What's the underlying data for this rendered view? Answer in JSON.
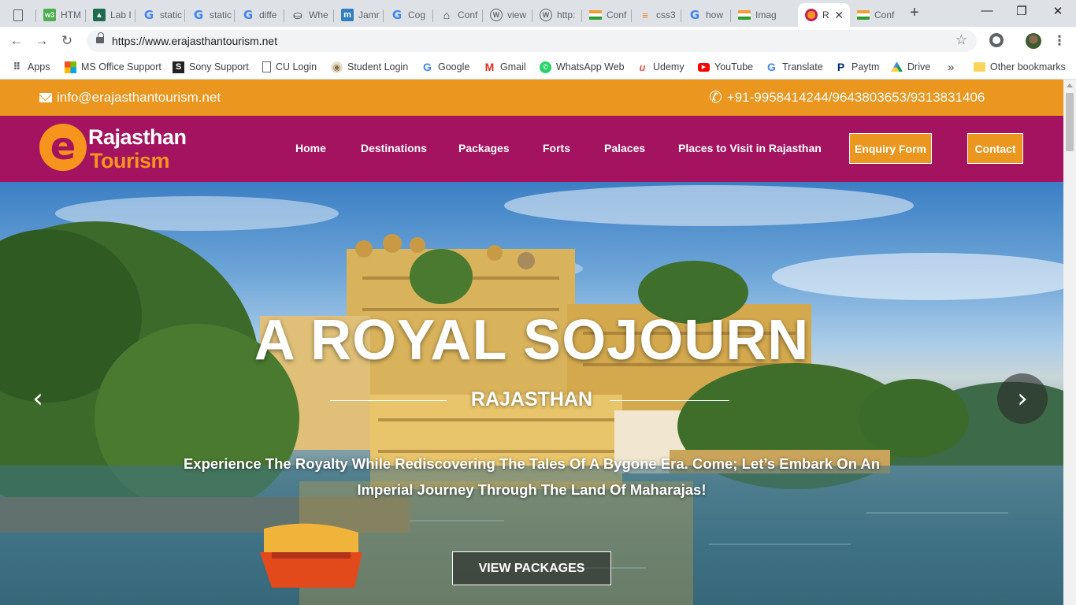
{
  "browser": {
    "tabs": [
      {
        "icon": "blank-page-icon",
        "title": ""
      },
      {
        "icon": "w3schools-icon",
        "title": "HTM"
      },
      {
        "icon": "lab-icon",
        "title": "Lab I"
      },
      {
        "icon": "google-icon",
        "title": "static"
      },
      {
        "icon": "google-icon",
        "title": "static"
      },
      {
        "icon": "google-icon",
        "title": "diffe"
      },
      {
        "icon": "wheel-icon",
        "title": "Whe"
      },
      {
        "icon": "jamboard-icon",
        "title": "Jamr"
      },
      {
        "icon": "google-icon",
        "title": "Cog"
      },
      {
        "icon": "home-icon",
        "title": "Conf"
      },
      {
        "icon": "wordpress-icon",
        "title": "view"
      },
      {
        "icon": "wordpress-icon",
        "title": "http:"
      },
      {
        "icon": "india-flag-icon",
        "title": "Conf"
      },
      {
        "icon": "stackoverflow-icon",
        "title": "css3"
      },
      {
        "icon": "google-icon",
        "title": "how"
      },
      {
        "icon": "india-flag-icon",
        "title": "Imag"
      },
      {
        "icon": "erajasthan-icon",
        "title": "R"
      },
      {
        "icon": "india-flag-icon",
        "title": "Conf"
      }
    ],
    "new_tab": "+",
    "window_controls": {
      "minimize": "—",
      "maximize": "❐",
      "close": "✕"
    },
    "url": "https://www.erajasthantourism.net",
    "bookmarks": [
      {
        "icon": "apps-grid-icon",
        "label": "Apps"
      },
      {
        "icon": "microsoft-icon",
        "label": "MS Office Support"
      },
      {
        "icon": "sony-icon",
        "label": "Sony Support"
      },
      {
        "icon": "page-icon",
        "label": "CU Login"
      },
      {
        "icon": "student-icon",
        "label": "Student Login"
      },
      {
        "icon": "google-icon",
        "label": "Google"
      },
      {
        "icon": "gmail-icon",
        "label": "Gmail"
      },
      {
        "icon": "whatsapp-icon",
        "label": "WhatsApp Web"
      },
      {
        "icon": "udemy-icon",
        "label": "Udemy"
      },
      {
        "icon": "youtube-icon",
        "label": "YouTube"
      },
      {
        "icon": "translate-icon",
        "label": "Translate"
      },
      {
        "icon": "paytm-icon",
        "label": "Paytm"
      },
      {
        "icon": "drive-icon",
        "label": "Drive"
      }
    ],
    "bookmarks_overflow": "»",
    "other_bookmarks": "Other bookmarks"
  },
  "site": {
    "email": "info@erajasthantourism.net",
    "phone": "+91-9958414244/9643803653/9313831406",
    "logo": {
      "letter": "e",
      "line1": "Rajasthan",
      "line2": "Tourism"
    },
    "nav": [
      "Home",
      "Destinations",
      "Packages",
      "Forts",
      "Palaces",
      "Places to Visit in Rajasthan"
    ],
    "enquiry_button": "Enquiry Form",
    "contact_button": "Contact",
    "hero": {
      "title": "A ROYAL SOJOURN",
      "subtitle": "RAJASTHAN",
      "tagline": "Experience The Royalty While Rediscovering The Tales Of A Bygone Era. Come; Let’s Embark On An Imperial Journey Through The Land Of Maharajas!",
      "cta": "VIEW PACKAGES",
      "prev": "‹",
      "next": "›"
    },
    "colors": {
      "topbar": "#ea961f",
      "nav": "#a3135f",
      "accent": "#f7941d"
    }
  }
}
